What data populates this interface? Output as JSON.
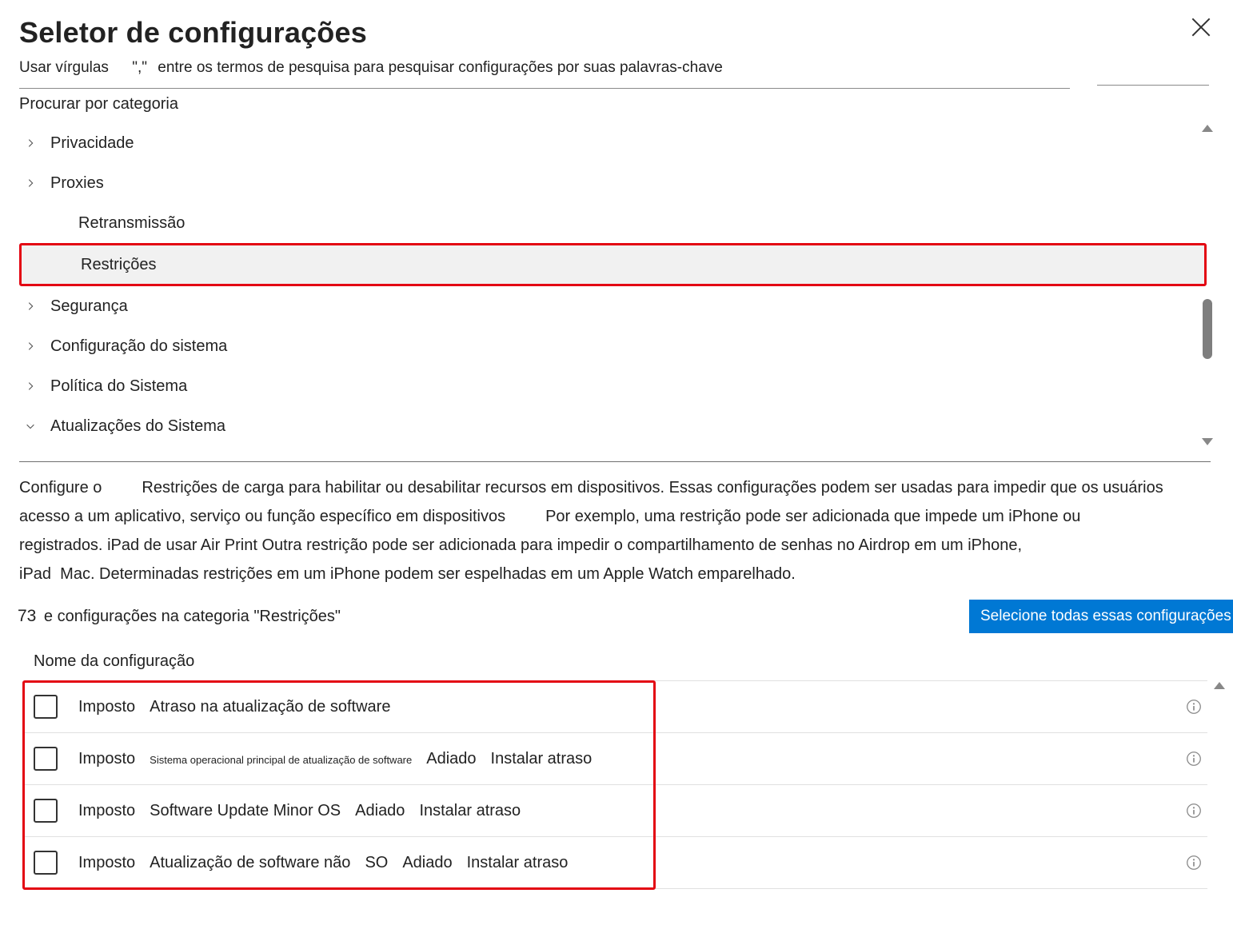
{
  "title": "Seletor de configurações",
  "subtitle": {
    "seg1": "Usar vírgulas",
    "quote": "\",\"",
    "seg2": "entre os termos de pesquisa para pesquisar configurações por suas palavras-chave"
  },
  "browse_label": "Procurar por categoria",
  "categories": [
    {
      "label": "Privacidade",
      "expandable": true,
      "open": false,
      "highlighted": false,
      "indent": false
    },
    {
      "label": "Proxies",
      "expandable": true,
      "open": false,
      "highlighted": false,
      "indent": false
    },
    {
      "label": "Retransmissão",
      "expandable": false,
      "open": false,
      "highlighted": false,
      "indent": true
    },
    {
      "label": "Restrições",
      "expandable": false,
      "open": false,
      "highlighted": true,
      "indent": true
    },
    {
      "label": "Segurança",
      "expandable": true,
      "open": false,
      "highlighted": false,
      "indent": false
    },
    {
      "label": "Configuração do sistema",
      "expandable": true,
      "open": false,
      "highlighted": false,
      "indent": false
    },
    {
      "label": "Política do Sistema",
      "expandable": true,
      "open": false,
      "highlighted": false,
      "indent": false
    },
    {
      "label": "Atualizações do Sistema",
      "expandable": true,
      "open": true,
      "highlighted": false,
      "indent": false
    }
  ],
  "description": {
    "line1": {
      "seg1": "Configure o",
      "seg2": "Restrições de carga para habilitar ou desabilitar recursos em dispositivos. Essas configurações podem ser usadas para impedir que os usuários"
    },
    "line2": {
      "seg1": "acesso a um aplicativo, serviço ou função específico em dispositivos",
      "seg2": "Por exemplo, uma restrição pode ser adicionada que impede um iPhone ou"
    },
    "line3": {
      "seg1": "registrados.",
      "seg2": "iPad de usar Air Print",
      "seg3": "Outra restrição pode ser adicionada para impedir o compartilhamento de senhas no Airdrop em um iPhone,"
    },
    "line4": {
      "seg1": "iPad",
      "seg2": "Mac. Determinadas restrições em um iPhone podem ser espelhadas em um Apple Watch emparelhado."
    }
  },
  "count": {
    "number": "73",
    "text": "e configurações na categoria \"Restrições\""
  },
  "select_all_btn": "Selecione todas essas configurações",
  "column_header": "Nome da configuração",
  "settings": [
    {
      "parts": [
        "Imposto",
        "Atraso na atualização de software"
      ],
      "small_index": null
    },
    {
      "parts": [
        "Imposto",
        "Sistema operacional principal de atualização de software",
        "Adiado",
        "Instalar atraso"
      ],
      "small_index": 1
    },
    {
      "parts": [
        "Imposto",
        "Software Update Minor OS",
        "Adiado",
        "Instalar atraso"
      ],
      "small_index": null
    },
    {
      "parts": [
        "Imposto",
        "Atualização de software não",
        "SO",
        "Adiado",
        "Instalar atraso"
      ],
      "small_index": null
    }
  ]
}
